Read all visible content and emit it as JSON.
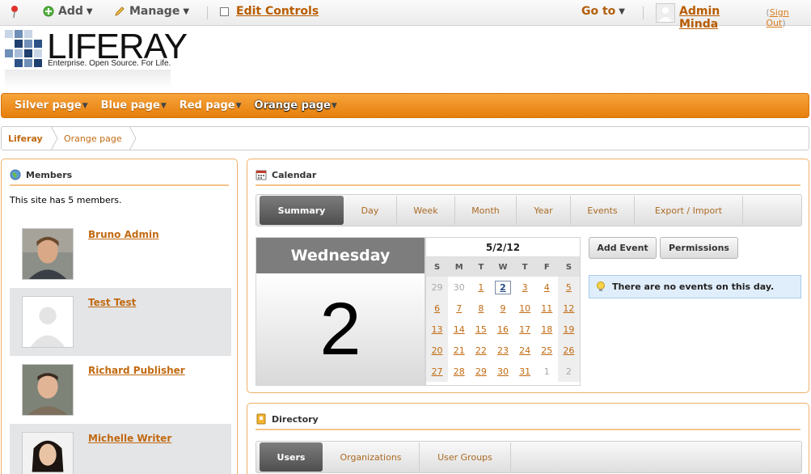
{
  "dockbar": {
    "add_label": "Add",
    "manage_label": "Manage",
    "edit_controls_label": "Edit Controls",
    "goto_label": "Go to",
    "user_name": "Admin Minda",
    "signout_label": "Sign Out"
  },
  "logo": {
    "name": "LIFERAY",
    "tagline": "Enterprise. Open Source. For Life."
  },
  "nav": {
    "items": [
      {
        "label": "Silver page"
      },
      {
        "label": "Blue page"
      },
      {
        "label": "Red page"
      },
      {
        "label": "Orange page"
      }
    ],
    "selected": "Orange page"
  },
  "breadcrumb": {
    "items": [
      "Liferay",
      "Orange page"
    ]
  },
  "members": {
    "title": "Members",
    "intro": "This site has 5 members.",
    "list": [
      {
        "name": "Bruno Admin"
      },
      {
        "name": "Test Test"
      },
      {
        "name": "Richard Publisher"
      },
      {
        "name": "Michelle Writer"
      }
    ]
  },
  "calendar": {
    "title": "Calendar",
    "tabs": [
      "Summary",
      "Day",
      "Week",
      "Month",
      "Year",
      "Events",
      "Export / Import"
    ],
    "selected_tab": "Summary",
    "weekday": "Wednesday",
    "day_number": "2",
    "mini_title": "5/2/12",
    "weekday_headers": [
      "S",
      "M",
      "T",
      "W",
      "T",
      "F",
      "S"
    ],
    "weeks": [
      [
        "29",
        "30",
        "1",
        "2",
        "3",
        "4",
        "5"
      ],
      [
        "6",
        "7",
        "8",
        "9",
        "10",
        "11",
        "12"
      ],
      [
        "13",
        "14",
        "15",
        "16",
        "17",
        "18",
        "19"
      ],
      [
        "20",
        "21",
        "22",
        "23",
        "24",
        "25",
        "26"
      ],
      [
        "27",
        "28",
        "29",
        "30",
        "31",
        "1",
        "2"
      ]
    ],
    "today": "2",
    "add_event_label": "Add Event",
    "permissions_label": "Permissions",
    "no_events_text": "There are no events on this day."
  },
  "directory": {
    "title": "Directory",
    "tabs": [
      "Users",
      "Organizations",
      "User Groups"
    ],
    "selected_tab": "Users"
  },
  "colors": {
    "accent_orange": "#e8860f",
    "link_orange": "#c16a12",
    "portlet_border": "#f0b06a"
  }
}
